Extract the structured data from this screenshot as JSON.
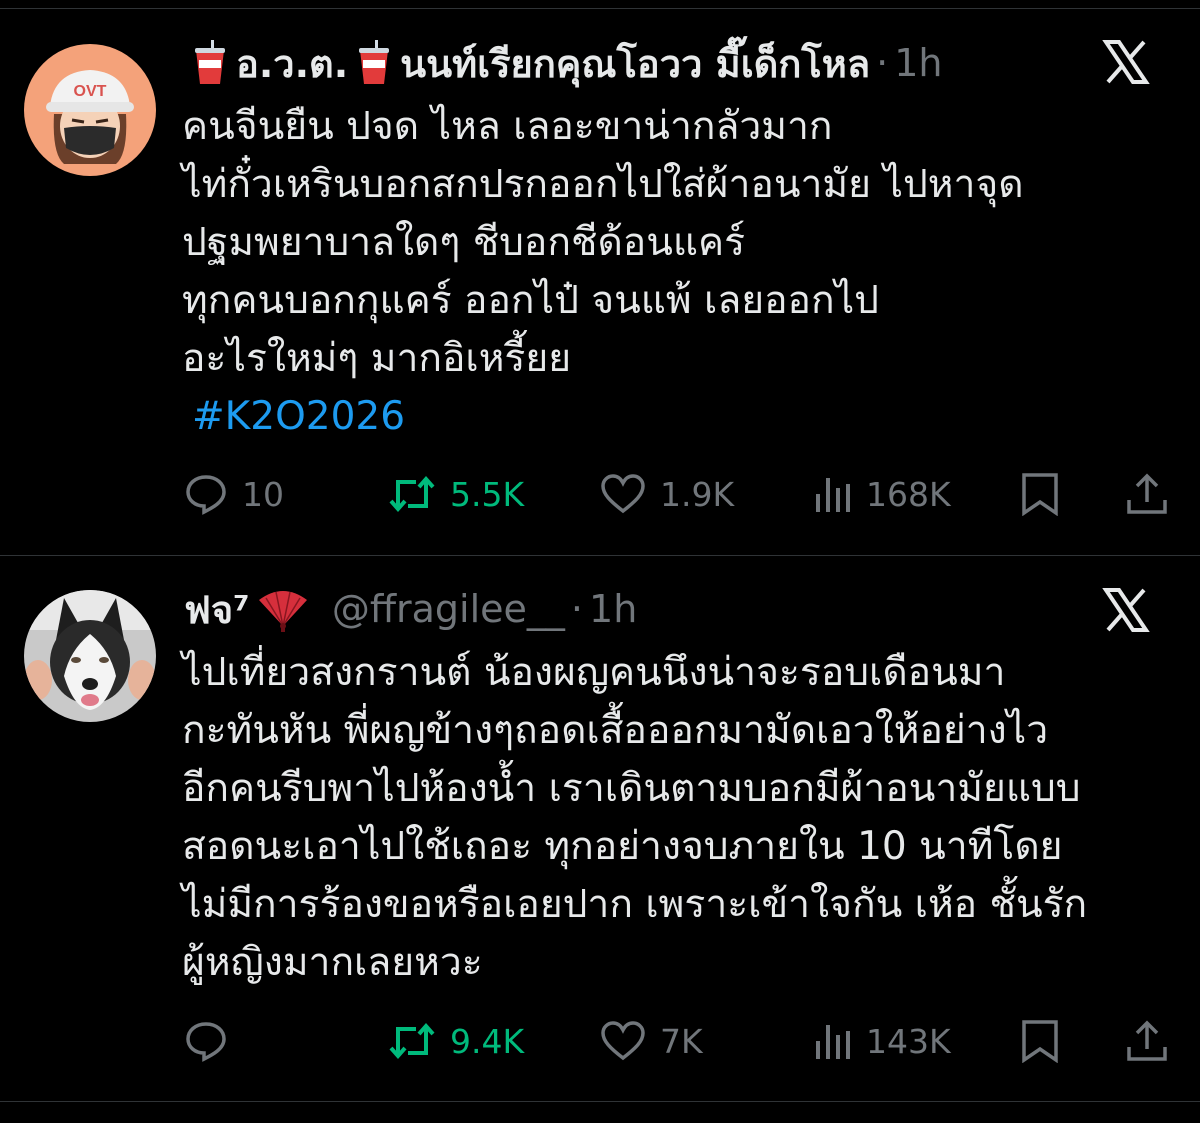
{
  "tweets": [
    {
      "display_name_part1": "อ.ว.ต.",
      "display_name_part2": "นนท์เรียกคุณโอวว มี๊เด็กโหล",
      "dot": "·",
      "time": "1h",
      "avatar_text": "OVT",
      "lines": [
        "คนจีนยืน ปจด ไหล เลอะขาน่ากลัวมาก",
        "ไท่กั๋วเหรินบอกสกปรกออกไปใส่ผ้าอนามัย ไปหาจุด",
        "ปฐมพยาบาลใดๆ ชีบอกชีด้อนแคร์",
        "ทุกคนบอกกุแคร์ ออกไป๋ จนแพ้ เลยออกไป",
        "อะไรใหม่ๆ มากอิเหรี้ยย"
      ],
      "hashtag": "#K2O2026",
      "replies": "10",
      "reposts": "5.5K",
      "likes": "1.9K",
      "views": "168K"
    },
    {
      "display_name": "ฟจ⁷",
      "handle": "@ffragilee__",
      "dot": "·",
      "time": "1h",
      "lines": [
        "ไปเที่ยวสงกรานต์ น้องผญคนนึงน่าจะรอบเดือนมา",
        "กะทันหัน พี่ผญข้างๆถอดเสื้อออกมามัดเอวให้อย่างไว",
        "อีกคนรีบพาไปห้องน้ำ เราเดินตามบอกมีผ้าอนามัยแบบ",
        "สอดนะเอาไปใช้เถอะ ทุกอย่างจบภายใน 10 นาทีโดย",
        "ไม่มีการร้องขอหรือเอยปาก เพราะเข้าใจกัน เห้อ ชั้นรัก",
        "ผู้หญิงมากเลยหวะ"
      ],
      "replies": "",
      "reposts": "9.4K",
      "likes": "7K",
      "views": "143K"
    }
  ],
  "icons": {
    "reply": "speech-bubble-icon",
    "repost": "repost-arrows-icon",
    "like": "heart-icon",
    "views": "bar-chart-icon",
    "bookmark": "bookmark-icon",
    "share": "share-upload-icon",
    "x": "x-logo-icon",
    "cup": "soda-cup-emoji",
    "fan": "red-fan-emoji"
  },
  "colors": {
    "background": "#000000",
    "text": "#e7e9ea",
    "muted": "#71767b",
    "hashtag": "#1d9bf0",
    "repost": "#00ba7c",
    "divider": "#2f3336"
  }
}
